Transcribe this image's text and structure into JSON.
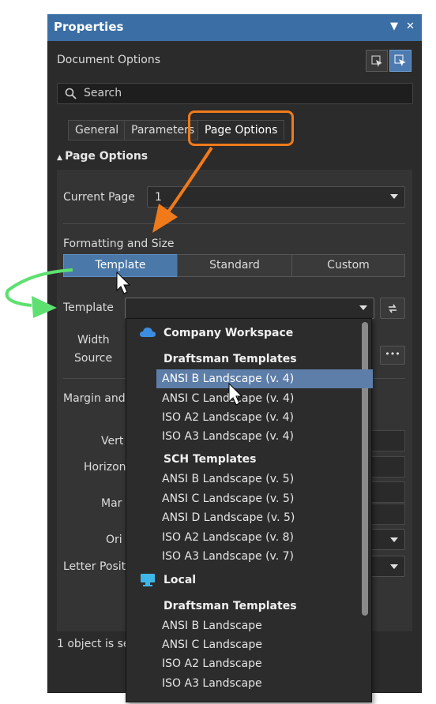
{
  "panel": {
    "title": "Properties",
    "controls": [
      "▼",
      "✕"
    ],
    "document_options": "Document Options",
    "search_placeholder": "Search",
    "tabs": [
      "General",
      "Parameters",
      "Page Options"
    ],
    "active_tab": "Page Options",
    "section": "Page Options"
  },
  "form": {
    "current_page_label": "Current Page",
    "current_page_value": "1",
    "formatting_label": "Formatting and Size",
    "segments": [
      "Template",
      "Standard",
      "Custom"
    ],
    "active_segment": "Template",
    "template_label": "Template",
    "template_value": "",
    "width_label": "Width",
    "source_label": "Source",
    "margin_label": "Margin and",
    "vert_label": "Vert",
    "horiz_label": "Horizon",
    "mar_label": "Mar",
    "ori_label": "Ori",
    "letter_label": "Letter Posit",
    "more_button": "•••"
  },
  "dropdown": {
    "groups": [
      {
        "name": "Company Workspace",
        "icon": "cloud-icon",
        "subgroups": [
          {
            "name": "Draftsman Templates",
            "items": [
              "ANSI B Landscape (v. 4)",
              "ANSI C Landscape (v. 4)",
              "ISO A2 Landscape (v. 4)",
              "ISO A3 Landscape (v. 4)"
            ]
          },
          {
            "name": "SCH Templates",
            "items": [
              "ANSI B Landscape (v. 5)",
              "ANSI C Landscape (v. 5)",
              "ANSI D Landscape (v. 5)",
              "ISO A2 Landscape (v. 8)",
              "ISO A3 Landscape (v. 7)"
            ]
          }
        ]
      },
      {
        "name": "Local",
        "icon": "monitor-icon",
        "subgroups": [
          {
            "name": "Draftsman Templates",
            "items": [
              "ANSI B Landscape",
              "ANSI C Landscape",
              "ISO A2 Landscape",
              "ISO A3 Landscape"
            ]
          }
        ]
      }
    ],
    "highlighted": "ANSI B Landscape (v. 4)"
  },
  "status": "1 object is se",
  "colors": {
    "accent": "#3a6ea5",
    "highlight": "#5d7ea8",
    "callout": "#f07a1a",
    "green_arrow": "#5ee070"
  }
}
